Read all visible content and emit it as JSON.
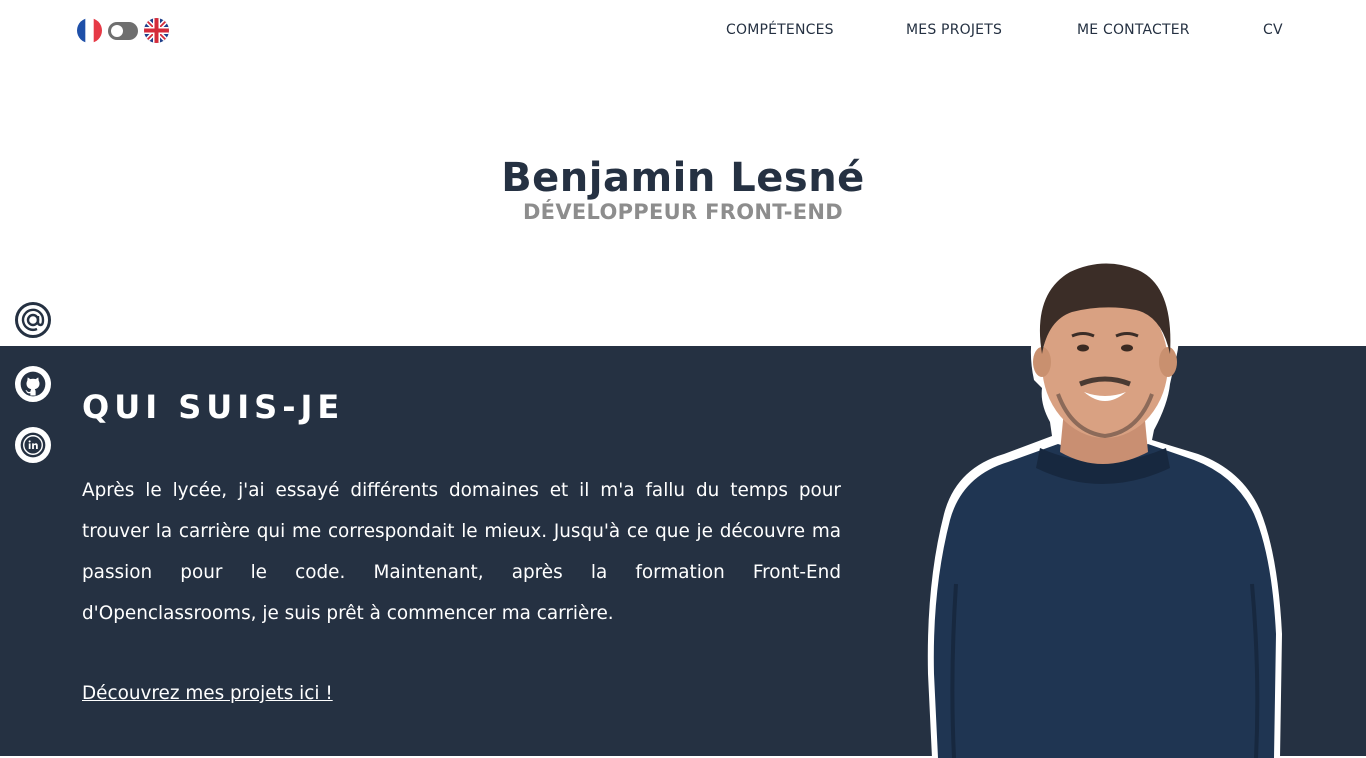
{
  "language_switch": {
    "left_flag": "french-flag-icon",
    "right_flag": "uk-flag-icon",
    "toggle_icon": "toggle-switch-icon"
  },
  "nav": {
    "items": [
      {
        "label": "COMPÉTENCES"
      },
      {
        "label": "MES PROJETS"
      },
      {
        "label": "ME CONTACTER"
      },
      {
        "label": "CV"
      }
    ]
  },
  "hero": {
    "name": "Benjamin Lesné",
    "role": "DÉVELOPPEUR FRONT-END"
  },
  "socials": [
    {
      "icon": "at-sign-icon"
    },
    {
      "icon": "github-icon"
    },
    {
      "icon": "linkedin-icon"
    }
  ],
  "about": {
    "title": "QUI SUIS-JE",
    "text": "Après le lycée, j'ai essayé différents domaines et il m'a fallu du temps pour trouver la carrière qui me correspondait le mieux. Jusqu'à ce que je découvre ma passion pour le code. Maintenant, après la formation  Front-End d'Openclassrooms, je suis prêt à commencer ma carrière.",
    "link": "Découvrez mes projets ici !"
  },
  "colors": {
    "navy": "#253142",
    "grey_subtitle": "#8d8d8d",
    "sweater": "#1f3552"
  }
}
